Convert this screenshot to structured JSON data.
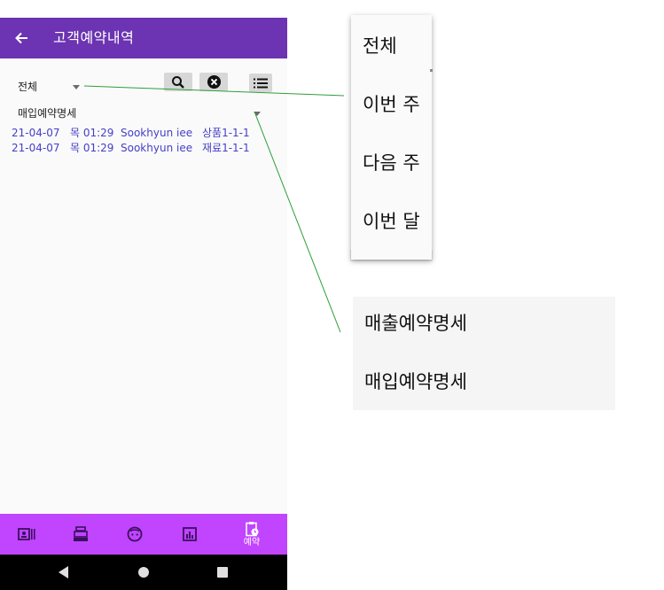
{
  "appbar": {
    "title": "고객예약내역"
  },
  "filter": {
    "period_selected": "전체",
    "type_selected": "매입예약명세"
  },
  "rows": [
    {
      "date": "21-04-07",
      "day_time": "목  01:29",
      "name": "Sookhyun iee",
      "item": "상품1-1-1"
    },
    {
      "date": "21-04-07",
      "day_time": "목  01:29",
      "name": "Sookhyun iee",
      "item": "재료1-1-1"
    }
  ],
  "bottom_nav": {
    "items": [
      {
        "icon": "contacts-icon",
        "label": ""
      },
      {
        "icon": "cash-register-icon",
        "label": ""
      },
      {
        "icon": "face-icon",
        "label": ""
      },
      {
        "icon": "chart-icon",
        "label": ""
      },
      {
        "icon": "clipboard-clock-icon",
        "label": "예약"
      }
    ]
  },
  "period_popup": {
    "options": [
      "전체",
      "이번 주",
      "다음 주",
      "이번 달"
    ]
  },
  "type_popup": {
    "options": [
      "매출예약명세",
      "매입예약명세"
    ]
  },
  "colors": {
    "appbar": "#6c33b2",
    "bottom_nav": "#c144ff",
    "row_text": "#4540c8",
    "connector": "#2e9e3a"
  }
}
